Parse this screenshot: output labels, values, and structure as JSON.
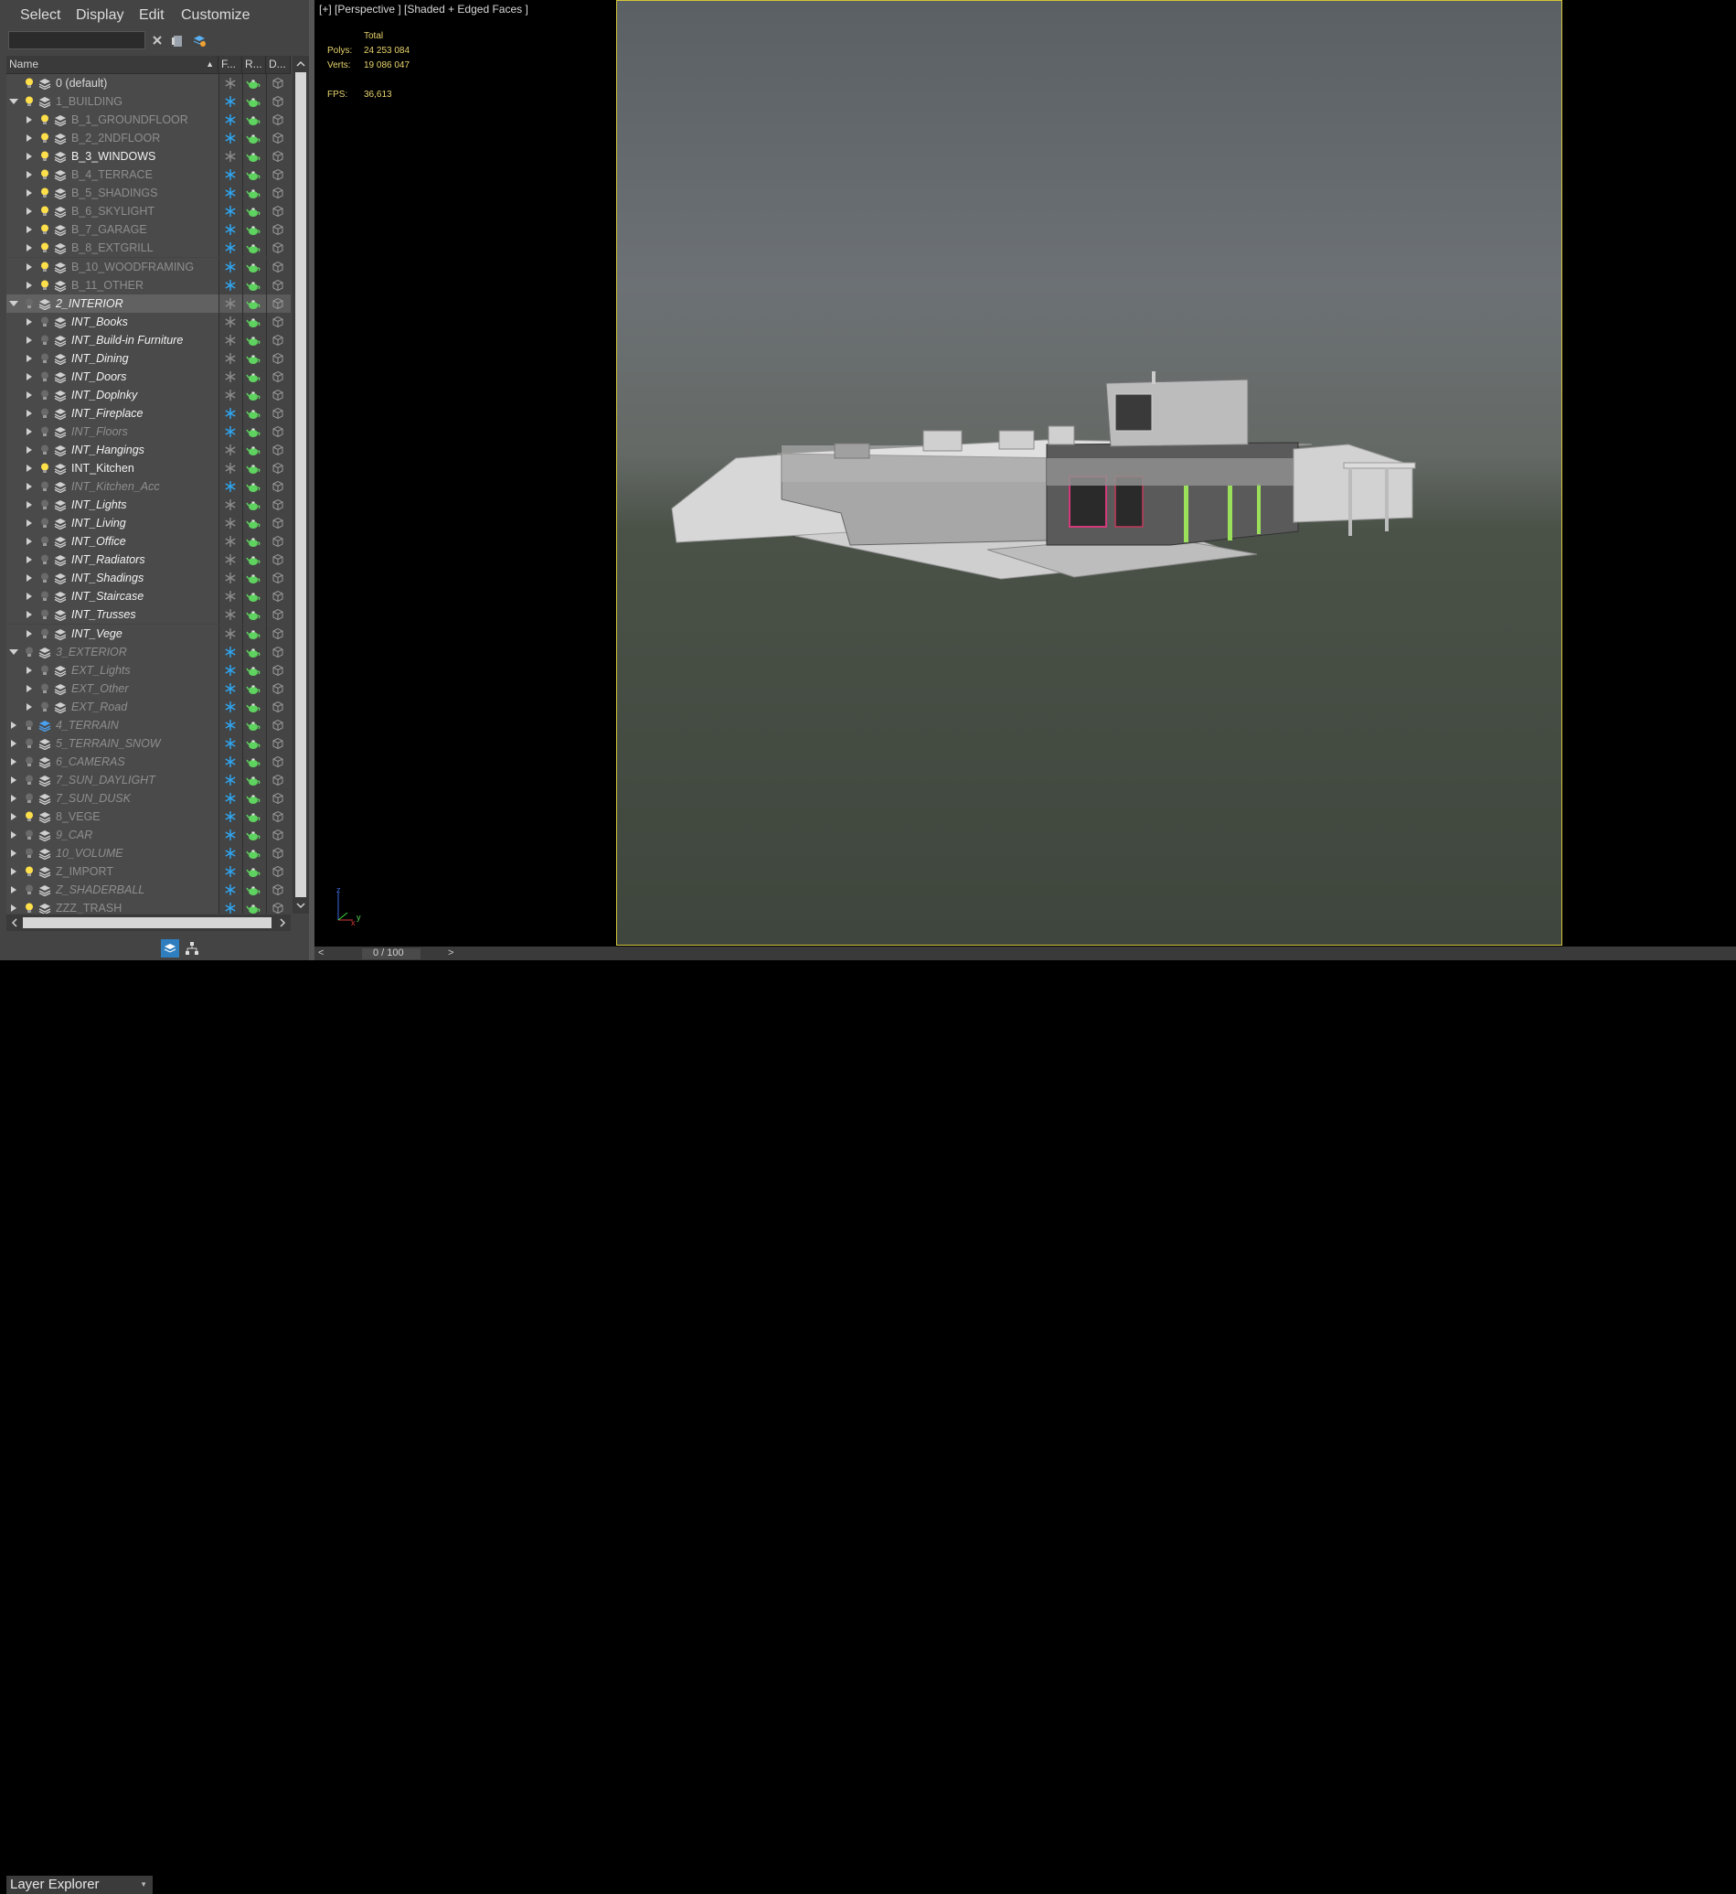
{
  "menu": [
    "Select",
    "Display",
    "Edit",
    "Customize"
  ],
  "search": {
    "placeholder": "",
    "value": ""
  },
  "columns": {
    "name": "Name",
    "freeze": "F...",
    "render": "R...",
    "display": "D..."
  },
  "layers": [
    {
      "name": "0 (default)",
      "depth": 0,
      "expander": "none",
      "bulb": true,
      "style": "light",
      "freeze": "off",
      "layer_icon": "gray"
    },
    {
      "name": "1_BUILDING",
      "depth": 0,
      "expander": "down",
      "bulb": true,
      "style": "gray",
      "freeze": "on",
      "layer_icon": "gray"
    },
    {
      "name": "B_1_GROUNDFLOOR",
      "depth": 1,
      "expander": "right",
      "bulb": true,
      "style": "gray",
      "freeze": "on",
      "layer_icon": "gray"
    },
    {
      "name": "B_2_2NDFLOOR",
      "depth": 1,
      "expander": "right",
      "bulb": true,
      "style": "gray",
      "freeze": "on",
      "layer_icon": "gray"
    },
    {
      "name": "B_3_WINDOWS",
      "depth": 1,
      "expander": "right",
      "bulb": true,
      "style": "white",
      "freeze": "off",
      "layer_icon": "gray"
    },
    {
      "name": "B_4_TERRACE",
      "depth": 1,
      "expander": "right",
      "bulb": true,
      "style": "gray",
      "freeze": "on",
      "layer_icon": "gray"
    },
    {
      "name": "B_5_SHADINGS",
      "depth": 1,
      "expander": "right",
      "bulb": true,
      "style": "gray",
      "freeze": "on",
      "layer_icon": "gray"
    },
    {
      "name": "B_6_SKYLIGHT",
      "depth": 1,
      "expander": "right",
      "bulb": true,
      "style": "gray",
      "freeze": "on",
      "layer_icon": "gray"
    },
    {
      "name": "B_7_GARAGE",
      "depth": 1,
      "expander": "right",
      "bulb": true,
      "style": "gray",
      "freeze": "on",
      "layer_icon": "gray"
    },
    {
      "name": "B_8_EXTGRILL",
      "depth": 1,
      "expander": "right",
      "bulb": true,
      "style": "gray",
      "freeze": "on",
      "layer_icon": "gray"
    },
    {
      "name": "B_10_WOODFRAMING",
      "depth": 1,
      "expander": "right",
      "bulb": true,
      "style": "gray",
      "freeze": "on",
      "layer_icon": "gray"
    },
    {
      "name": "B_11_OTHER",
      "depth": 1,
      "expander": "right",
      "bulb": true,
      "style": "gray",
      "freeze": "on",
      "layer_icon": "gray"
    },
    {
      "name": "2_INTERIOR",
      "depth": 0,
      "expander": "down",
      "bulb": false,
      "style": "white-italic",
      "freeze": "off",
      "layer_icon": "gray",
      "selected": true
    },
    {
      "name": "INT_Books",
      "depth": 1,
      "expander": "right",
      "bulb": false,
      "style": "white-italic",
      "freeze": "off",
      "layer_icon": "gray"
    },
    {
      "name": "INT_Build-in Furniture",
      "depth": 1,
      "expander": "right",
      "bulb": false,
      "style": "white-italic",
      "freeze": "off",
      "layer_icon": "gray"
    },
    {
      "name": "INT_Dining",
      "depth": 1,
      "expander": "right",
      "bulb": false,
      "style": "white-italic",
      "freeze": "off",
      "layer_icon": "gray"
    },
    {
      "name": "INT_Doors",
      "depth": 1,
      "expander": "right",
      "bulb": false,
      "style": "white-italic",
      "freeze": "off",
      "layer_icon": "gray"
    },
    {
      "name": "INT_Doplnky",
      "depth": 1,
      "expander": "right",
      "bulb": false,
      "style": "white-italic",
      "freeze": "off",
      "layer_icon": "gray"
    },
    {
      "name": "INT_Fireplace",
      "depth": 1,
      "expander": "right",
      "bulb": false,
      "style": "white-italic",
      "freeze": "on",
      "layer_icon": "gray"
    },
    {
      "name": "INT_Floors",
      "depth": 1,
      "expander": "right",
      "bulb": false,
      "style": "gray-italic",
      "freeze": "on",
      "layer_icon": "gray"
    },
    {
      "name": "INT_Hangings",
      "depth": 1,
      "expander": "right",
      "bulb": false,
      "style": "white-italic",
      "freeze": "off",
      "layer_icon": "gray"
    },
    {
      "name": "INT_Kitchen",
      "depth": 1,
      "expander": "right",
      "bulb": true,
      "style": "white",
      "freeze": "off",
      "layer_icon": "gray"
    },
    {
      "name": "INT_Kitchen_Acc",
      "depth": 1,
      "expander": "right",
      "bulb": false,
      "style": "gray-italic",
      "freeze": "on",
      "layer_icon": "gray"
    },
    {
      "name": "INT_Lights",
      "depth": 1,
      "expander": "right",
      "bulb": false,
      "style": "white-italic",
      "freeze": "off",
      "layer_icon": "gray"
    },
    {
      "name": "INT_Living",
      "depth": 1,
      "expander": "right",
      "bulb": false,
      "style": "white-italic",
      "freeze": "off",
      "layer_icon": "gray"
    },
    {
      "name": "INT_Office",
      "depth": 1,
      "expander": "right",
      "bulb": false,
      "style": "white-italic",
      "freeze": "off",
      "layer_icon": "gray"
    },
    {
      "name": "INT_Radiators",
      "depth": 1,
      "expander": "right",
      "bulb": false,
      "style": "white-italic",
      "freeze": "off",
      "layer_icon": "gray"
    },
    {
      "name": "INT_Shadings",
      "depth": 1,
      "expander": "right",
      "bulb": false,
      "style": "white-italic",
      "freeze": "off",
      "layer_icon": "gray"
    },
    {
      "name": "INT_Staircase",
      "depth": 1,
      "expander": "right",
      "bulb": false,
      "style": "white-italic",
      "freeze": "off",
      "layer_icon": "gray"
    },
    {
      "name": "INT_Trusses",
      "depth": 1,
      "expander": "right",
      "bulb": false,
      "style": "white-italic",
      "freeze": "off",
      "layer_icon": "gray"
    },
    {
      "name": "INT_Vege",
      "depth": 1,
      "expander": "right",
      "bulb": false,
      "style": "white-italic",
      "freeze": "off",
      "layer_icon": "gray"
    },
    {
      "name": "3_EXTERIOR",
      "depth": 0,
      "expander": "down",
      "bulb": false,
      "style": "gray-italic",
      "freeze": "on",
      "layer_icon": "gray"
    },
    {
      "name": "EXT_Lights",
      "depth": 1,
      "expander": "right",
      "bulb": false,
      "style": "gray-italic",
      "freeze": "on",
      "layer_icon": "gray"
    },
    {
      "name": "EXT_Other",
      "depth": 1,
      "expander": "right",
      "bulb": false,
      "style": "gray-italic",
      "freeze": "on",
      "layer_icon": "gray"
    },
    {
      "name": "EXT_Road",
      "depth": 1,
      "expander": "right",
      "bulb": false,
      "style": "gray-italic",
      "freeze": "on",
      "layer_icon": "gray"
    },
    {
      "name": "4_TERRAIN",
      "depth": 0,
      "expander": "right",
      "bulb": false,
      "style": "gray-italic",
      "freeze": "on",
      "layer_icon": "blue"
    },
    {
      "name": "5_TERRAIN_SNOW",
      "depth": 0,
      "expander": "right",
      "bulb": false,
      "style": "gray-italic",
      "freeze": "on",
      "layer_icon": "gray"
    },
    {
      "name": "6_CAMERAS",
      "depth": 0,
      "expander": "right",
      "bulb": false,
      "style": "gray-italic",
      "freeze": "on",
      "layer_icon": "gray"
    },
    {
      "name": "7_SUN_DAYLIGHT",
      "depth": 0,
      "expander": "right",
      "bulb": false,
      "style": "gray-italic",
      "freeze": "on",
      "layer_icon": "gray"
    },
    {
      "name": "7_SUN_DUSK",
      "depth": 0,
      "expander": "right",
      "bulb": false,
      "style": "gray-italic",
      "freeze": "on",
      "layer_icon": "gray"
    },
    {
      "name": "8_VEGE",
      "depth": 0,
      "expander": "right",
      "bulb": true,
      "style": "gray",
      "freeze": "on",
      "layer_icon": "gray"
    },
    {
      "name": "9_CAR",
      "depth": 0,
      "expander": "right",
      "bulb": false,
      "style": "gray-italic",
      "freeze": "on",
      "layer_icon": "gray"
    },
    {
      "name": "10_VOLUME",
      "depth": 0,
      "expander": "right",
      "bulb": false,
      "style": "gray-italic",
      "freeze": "on",
      "layer_icon": "gray"
    },
    {
      "name": "Z_IMPORT",
      "depth": 0,
      "expander": "right",
      "bulb": true,
      "style": "gray",
      "freeze": "on",
      "layer_icon": "gray"
    },
    {
      "name": "Z_SHADERBALL",
      "depth": 0,
      "expander": "right",
      "bulb": false,
      "style": "gray-italic",
      "freeze": "on",
      "layer_icon": "gray"
    },
    {
      "name": "ZZZ_TRASH",
      "depth": 0,
      "expander": "right",
      "bulb": true,
      "style": "gray",
      "freeze": "on",
      "layer_icon": "gray"
    }
  ],
  "bottom": {
    "explorer_label": "Layer Explorer"
  },
  "viewport": {
    "label": "[+] [Perspective ] [Shaded + Edged Faces ]",
    "stats_header": "Total",
    "polys_label": "Polys:",
    "polys_value": "24 253 084",
    "verts_label": "Verts:",
    "verts_value": "19 086 047",
    "fps_label": "FPS:",
    "fps_value": "36,613",
    "axis_x": "x",
    "axis_y": "y",
    "axis_z": "z"
  },
  "timeline": {
    "frame": "0 / 100"
  },
  "colors": {
    "freeze_on": "#2fa5f0",
    "freeze_off": "#8a8a8a",
    "teapot": "#5fd35f",
    "bulb_on": "#ffe04a",
    "viewport_border": "#d6c73a",
    "stat_text": "#e8d46e"
  }
}
